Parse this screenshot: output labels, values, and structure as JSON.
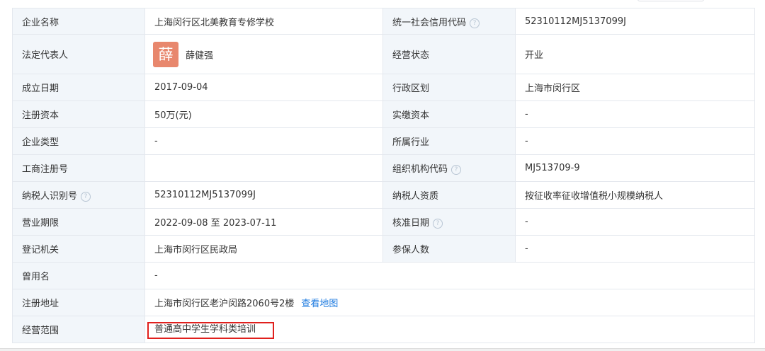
{
  "rows": [
    {
      "label": "企业名称",
      "value": "上海闵行区北美教育专修学校",
      "label2": "统一社会信用代码",
      "value2": "52310112MJ5137099J"
    },
    {
      "label": "法定代表人",
      "avatar_char": "薛",
      "value": "薛健强",
      "label2": "经营状态",
      "value2": "开业"
    },
    {
      "label": "成立日期",
      "value": "2017-09-04",
      "label2": "行政区划",
      "value2": "上海市闵行区"
    },
    {
      "label": "注册资本",
      "value": "50万(元)",
      "label2": "实缴资本",
      "value2": "-"
    },
    {
      "label": "企业类型",
      "value": "-",
      "label2": "所属行业",
      "value2": "-"
    },
    {
      "label": "工商注册号",
      "value": "",
      "label2": "组织机构代码",
      "value2": "MJ513709-9"
    },
    {
      "label": "纳税人识别号",
      "value": "52310112MJ5137099J",
      "label2": "纳税人资质",
      "value2": "按征收率征收增值税小规模纳税人"
    },
    {
      "label": "营业期限",
      "value": "2022-09-08 至 2023-07-11",
      "label2": "核准日期",
      "value2": "-"
    },
    {
      "label": "登记机关",
      "value": "上海市闵行区民政局",
      "label2": "参保人数",
      "value2": "-"
    },
    {
      "label": "曾用名",
      "value": "-"
    },
    {
      "label": "注册地址",
      "value": "上海市闵行区老沪闵路2060号2楼",
      "link": "查看地图"
    },
    {
      "label": "经营范围",
      "value": "普通高中学生学科类培训"
    }
  ],
  "help_icon_glyph": "?",
  "colors": {
    "label_bg": "#f2f6fa",
    "border": "#e4e8ee",
    "link": "#1e7be0",
    "highlight_border": "#e0201d",
    "avatar_bg": "#e8876d"
  }
}
